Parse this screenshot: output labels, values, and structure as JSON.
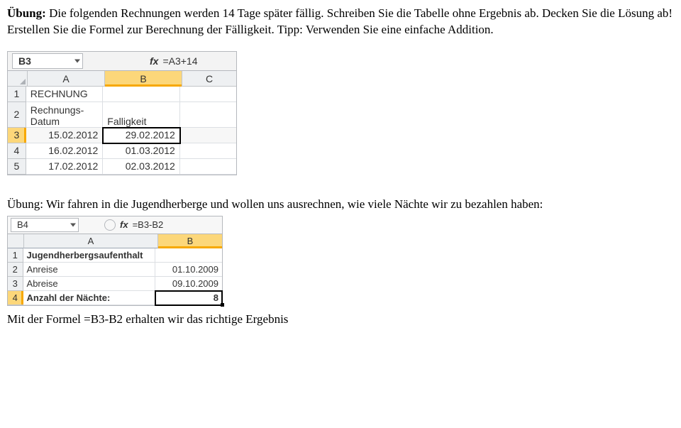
{
  "p1": {
    "lead": "Übung:",
    "rest": " Die folgenden Rechnungen werden 14 Tage später fällig. Schreiben Sie die Tabelle ohne Ergebnis ab. Decken Sie die Lösung ab! Erstellen Sie die Formel zur Berechnung der Fälligkeit. Tipp: Verwenden Sie eine einfache Addition."
  },
  "excel1": {
    "namebox": "B3",
    "fx": "fx",
    "formula": "=A3+14",
    "cols": {
      "A": "A",
      "B": "B",
      "C": "C"
    },
    "rows": {
      "1": {
        "A": "RECHNUNG",
        "B": "",
        "C": ""
      },
      "2": {
        "A": "Rechnungs-\nDatum",
        "B": "Falligkeit",
        "C": ""
      },
      "3": {
        "A": "15.02.2012",
        "B": "29.02.2012",
        "C": ""
      },
      "4": {
        "A": "16.02.2012",
        "B": "01.03.2012",
        "C": ""
      },
      "5": {
        "A": "17.02.2012",
        "B": "02.03.2012",
        "C": ""
      }
    }
  },
  "p2": "Übung: Wir fahren in die Jugendherberge und wollen uns ausrechnen, wie viele Nächte wir zu bezahlen haben:",
  "excel2": {
    "namebox": "B4",
    "fx": "fx",
    "formula": "=B3-B2",
    "cols": {
      "A": "A",
      "B": "B"
    },
    "rows": {
      "1": {
        "A": "Jugendherbergsaufenthalt",
        "B": ""
      },
      "2": {
        "A": "Anreise",
        "B": "01.10.2009"
      },
      "3": {
        "A": "Abreise",
        "B": "09.10.2009"
      },
      "4": {
        "A": "Anzahl der Nächte:",
        "B": "8"
      }
    }
  },
  "p3": "Mit der Formel =B3-B2 erhalten wir das richtige Ergebnis"
}
